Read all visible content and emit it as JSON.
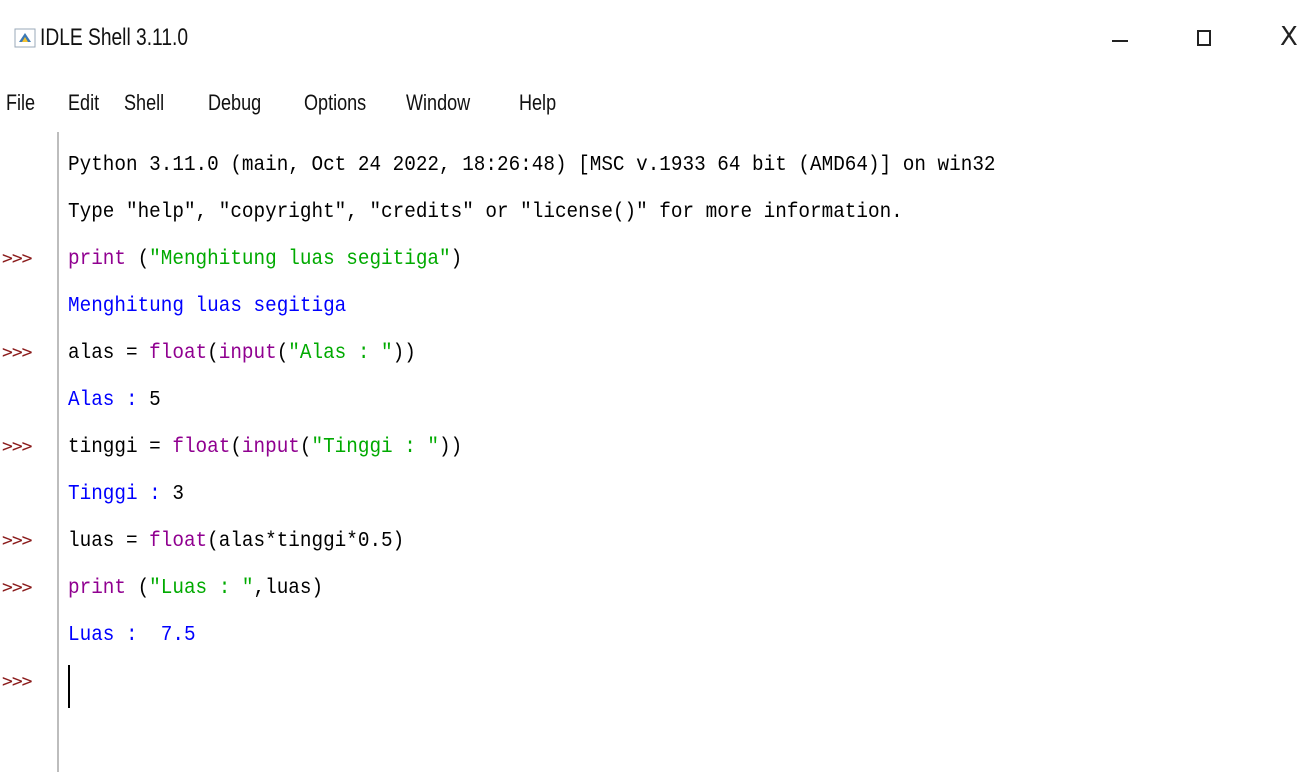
{
  "window": {
    "title": "IDLE Shell 3.11.0",
    "close_glyph": "X"
  },
  "menu": [
    "File",
    "Edit",
    "Shell",
    "Debug",
    "Options",
    "Window",
    "Help"
  ],
  "prompt_symbol": ">>>",
  "colors": {
    "prompt": "#8b1c1c",
    "string": "#00aa00",
    "builtin": "#900090",
    "output": "#0000ff",
    "default": "#000000"
  },
  "shell": {
    "banner": [
      "Python 3.11.0 (main, Oct 24 2022, 18:26:48) [MSC v.1933 64 bit (AMD64)] on win32",
      "Type \"help\", \"copyright\", \"credits\" or \"license()\" for more information."
    ],
    "cmd1": {
      "kw": "print",
      "rest": " (",
      "str": "\"Menghitung luas segitiga\"",
      "end": ")"
    },
    "out1": "Menghitung luas segitiga",
    "cmd2": {
      "pre": "alas = ",
      "b1": "float",
      "p1": "(",
      "b2": "input",
      "p2": "(",
      "str": "\"Alas : \"",
      "end": "))"
    },
    "out2": {
      "label": "Alas : ",
      "value": "5"
    },
    "cmd3": {
      "pre": "tinggi = ",
      "b1": "float",
      "p1": "(",
      "b2": "input",
      "p2": "(",
      "str": "\"Tinggi : \"",
      "end": "))"
    },
    "out3": {
      "label": "Tinggi : ",
      "value": "3"
    },
    "cmd4": {
      "pre": "luas = ",
      "b1": "float",
      "rest": "(alas*tinggi*0.5)"
    },
    "cmd5": {
      "kw": "print",
      "rest": " (",
      "str": "\"Luas : \"",
      "end": ",luas)"
    },
    "out5": "Luas :  7.5"
  }
}
